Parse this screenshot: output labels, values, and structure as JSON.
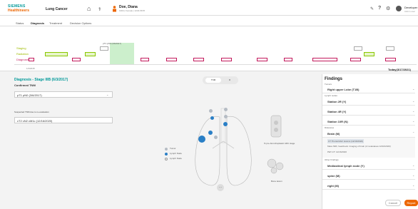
{
  "header": {
    "logo_line1": "SIEMENS",
    "logo_line2": "Healthineers",
    "app_title": "Lung Cancer",
    "patient_name": "Doe, Diana",
    "patient_sub": "1964 | Female | 1234-5678",
    "user_name": "Developer",
    "user_sub": "Admin user"
  },
  "tabs": [
    "Status",
    "Diagnosis",
    "Treatment",
    "Decision Options"
  ],
  "timeline": {
    "labels": [
      "Staging",
      "Radiation",
      "Diagnostic"
    ],
    "marker_label": "pT1 pN0 (3/6/2017)",
    "today_label": "Today(3/17/2021)",
    "start_label": "1/1/2015"
  },
  "diagnosis": {
    "title": "Diagnosis - Stage IIIB (6/3/2017)",
    "confirmed_label": "Confirmed TNM",
    "confirmed_value": "pT1 pN0 (3/6/2017)",
    "suspected_label": "Suspected TNM due to re-evaluation",
    "suspected_value": "cT2 cN2 cM1c (12/16/2020)",
    "toggle_on": "TNM",
    "toggle_off": "M"
  },
  "legend": {
    "items": [
      "Tumor",
      "Lymph Node",
      "Lymph Node"
    ]
  },
  "body_labels": {
    "lung": "% pre-bronchoplastic ADC stage",
    "bone": "Bone lesion"
  },
  "findings": {
    "title": "Findings",
    "tumor_header": "Tumors",
    "tumor_item": "Right upper Lobe (T1B)",
    "lymph_header": "Lymph nodes",
    "lymph_items": [
      "Station 2R (Y)",
      "Station 4R (Y)",
      "Station 10R (N)"
    ],
    "distant_header": "Distances",
    "distant_item": "Brain (M)",
    "distant_subs": [
      "CT Thorax/Abd: lesions (12/16/2020)",
      "Mass MRI, head/neck: Imaging of brain (2 metastases 12/16/2020)",
      "PET-CT: 12/16/2020"
    ],
    "other_header": "Other Findings",
    "other_items": [
      "Mediastinal lymph node (Y)",
      "spine (M)",
      "right (M)"
    ],
    "cancel_label": "Cancel",
    "save_label": "Report"
  },
  "colors": {
    "accent_orange": "#ec6602",
    "teal": "#009999",
    "lymph_blue": "#2a7fc6",
    "node_gray": "#b5bcc4"
  }
}
